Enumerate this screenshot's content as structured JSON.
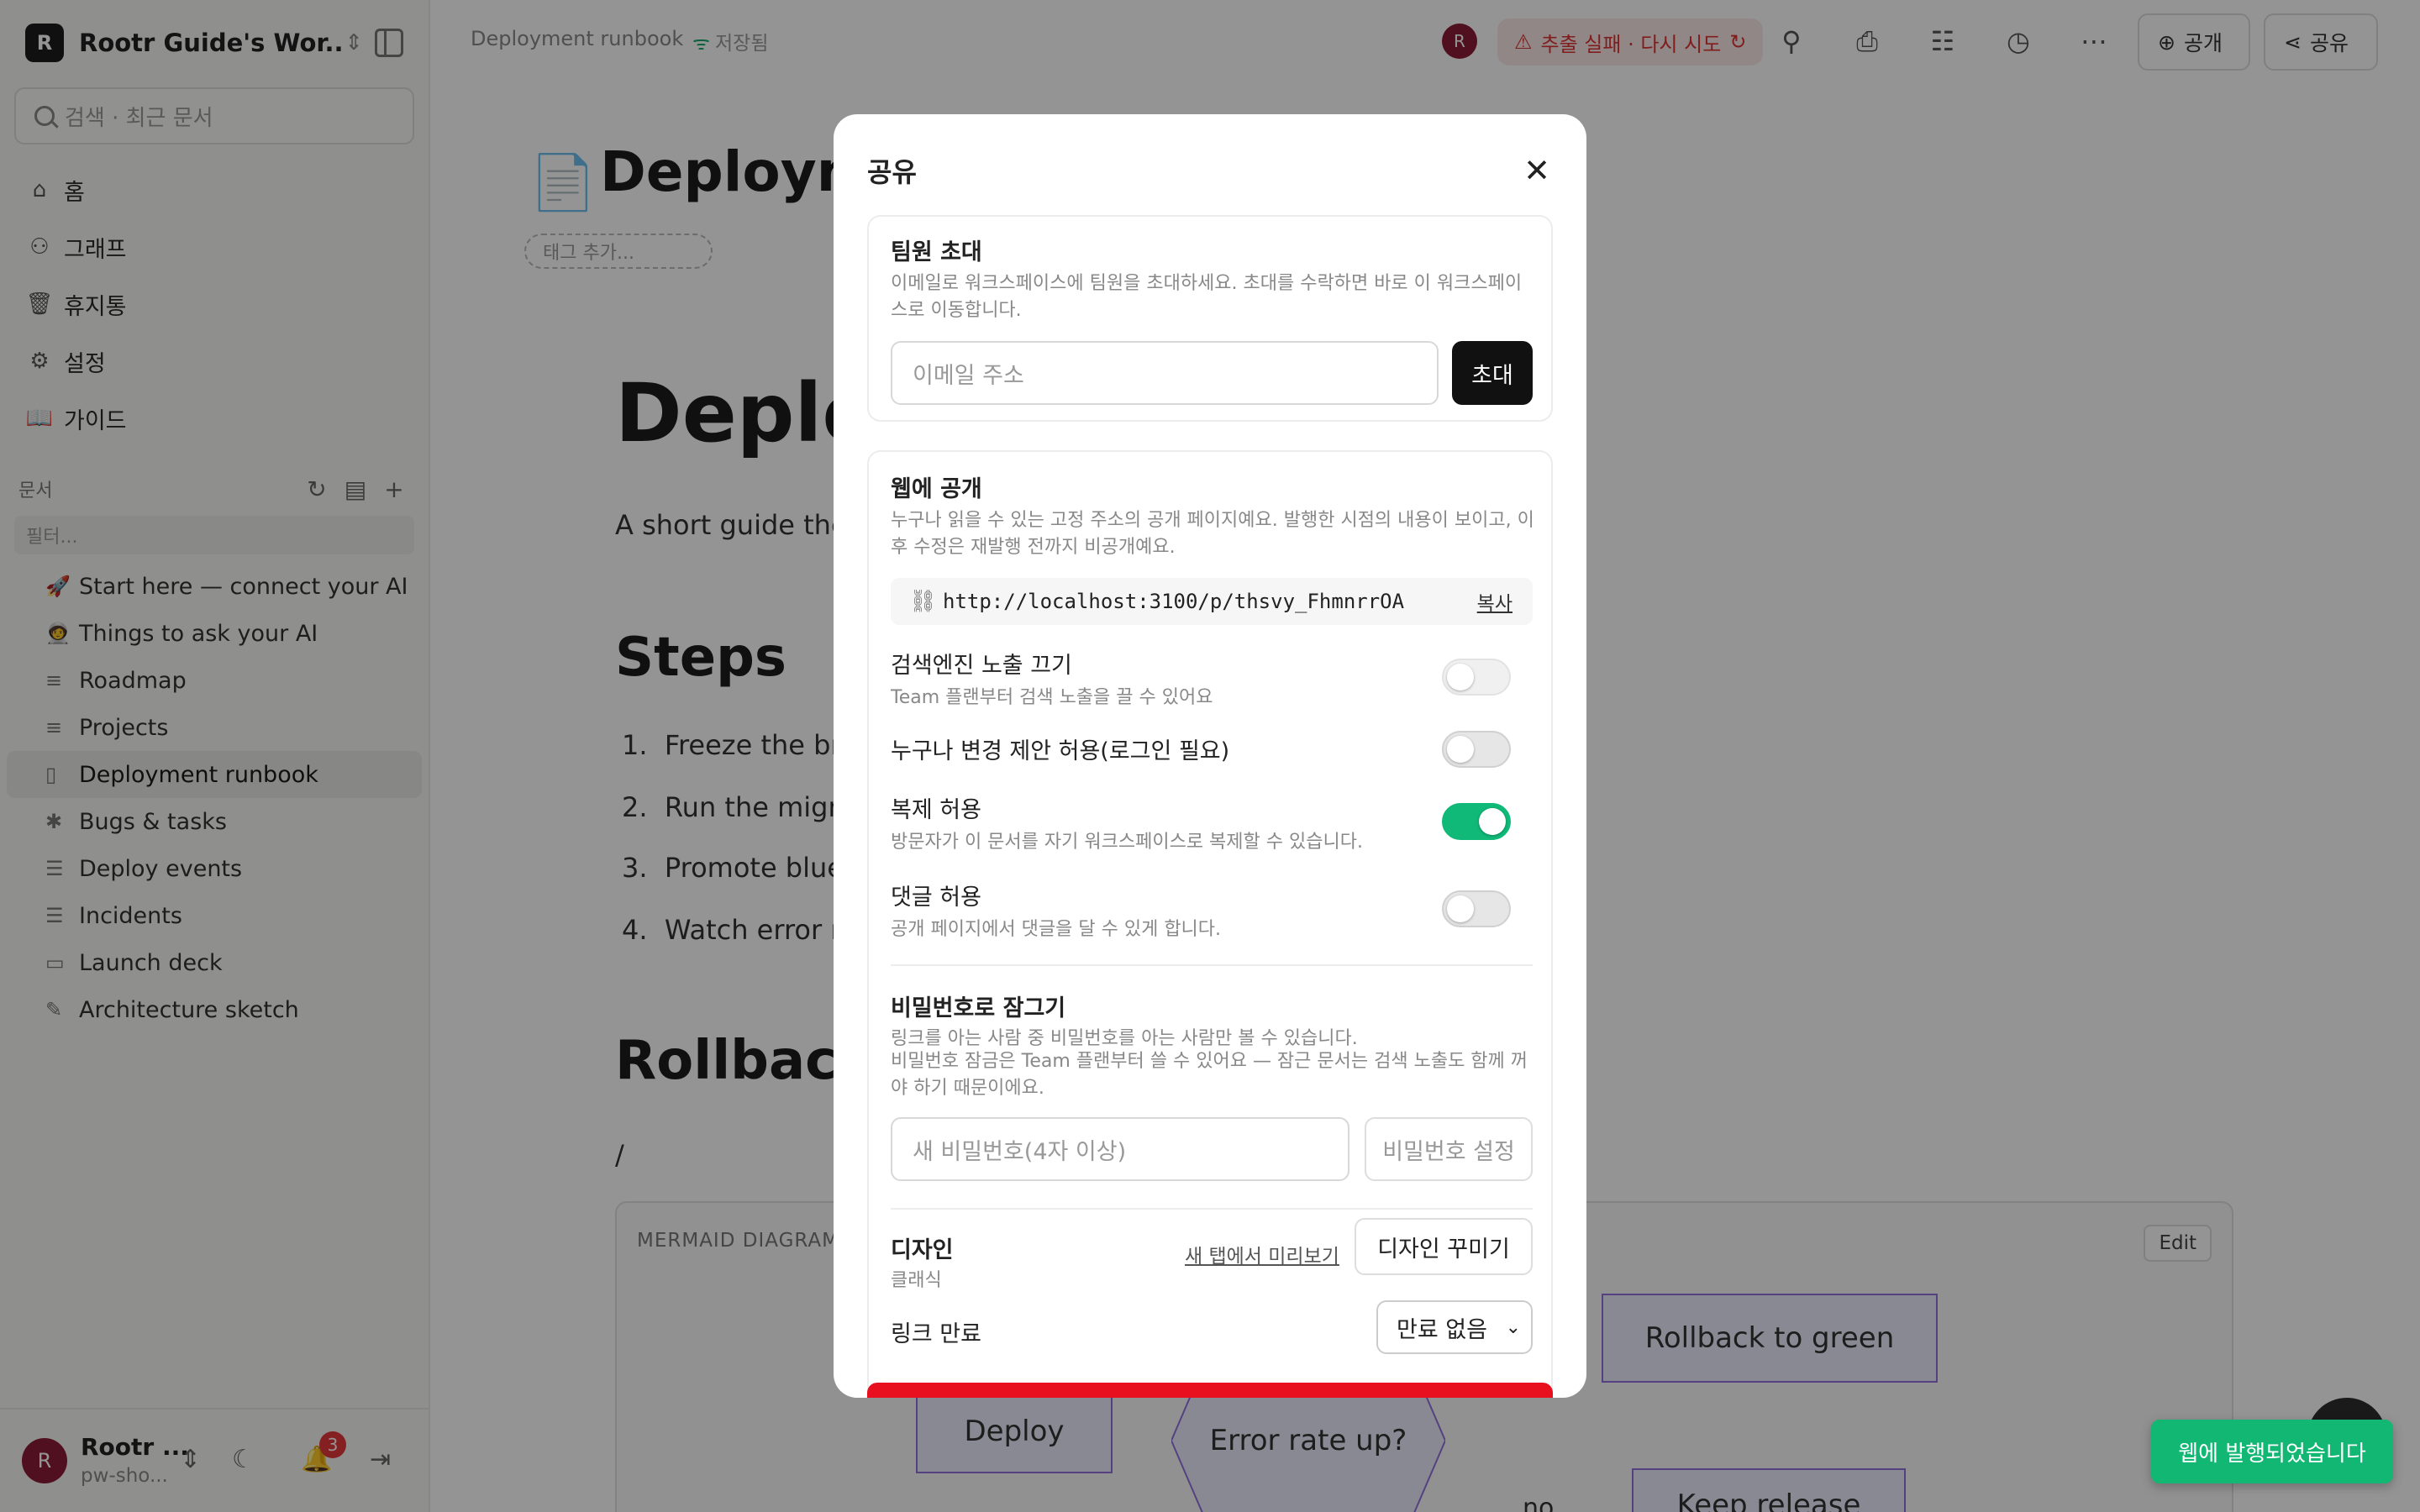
{
  "workspace": {
    "initial": "R",
    "name": "Rootr Guide's Wor..."
  },
  "search": {
    "placeholder": "검색 · 최근 문서"
  },
  "nav": [
    {
      "label": "홈",
      "icon": "home-icon"
    },
    {
      "label": "그래프",
      "icon": "graph-icon"
    },
    {
      "label": "휴지통",
      "icon": "trash-icon"
    },
    {
      "label": "설정",
      "icon": "gear-icon"
    },
    {
      "label": "가이드",
      "icon": "book-icon"
    }
  ],
  "docs": {
    "header": "문서",
    "filter_placeholder": "필터...",
    "items": [
      {
        "label": "Start here — connect your AI",
        "icon": "🚀"
      },
      {
        "label": "Things to ask your AI",
        "icon": "🧑‍🚀"
      },
      {
        "label": "Roadmap",
        "icon": "database-icon"
      },
      {
        "label": "Projects",
        "icon": "database-icon"
      },
      {
        "label": "Deployment runbook",
        "icon": "page-icon"
      },
      {
        "label": "Bugs & tasks",
        "icon": "bug-icon"
      },
      {
        "label": "Deploy events",
        "icon": "timeline-icon"
      },
      {
        "label": "Incidents",
        "icon": "timeline-icon"
      },
      {
        "label": "Launch deck",
        "icon": "slides-icon"
      },
      {
        "label": "Architecture sketch",
        "icon": "sketch-icon"
      }
    ]
  },
  "user": {
    "initial": "R",
    "name": "Rootr ...",
    "sub": "pw-sho...",
    "notifications": "3"
  },
  "topbar": {
    "breadcrumb": "Deployment runbook",
    "saved": "저장됨",
    "avatar": "R",
    "error": "추출 실패 · 다시 시도",
    "publish_label": "공개",
    "share_label": "공유"
  },
  "doc": {
    "emoji": "📄",
    "title": "Deployme",
    "tag_placeholder": "태그 추가...",
    "h1": "Deplo",
    "intro": "A short guide the",
    "steps_heading": "Steps",
    "steps": [
      "Freeze the bra",
      "Run the migra",
      "Promote blue",
      "Watch error ra"
    ],
    "rollback_heading": "Rollback",
    "slash": "/",
    "mermaid": {
      "label": "MERMAID DIAGRAM",
      "edit": "Edit",
      "nodes": {
        "rollback": "Rollback to green",
        "deploy": "Deploy",
        "error_rate": "Error rate up?",
        "keep": "Keep release",
        "no": "no"
      }
    }
  },
  "modal": {
    "title": "공유",
    "invite": {
      "title": "팀원 초대",
      "desc": "이메일로 워크스페이스에 팀원을 초대하세요. 초대를 수락하면 바로 이 워크스페이스로 이동합니다.",
      "email_placeholder": "이메일 주소",
      "button": "초대"
    },
    "publish": {
      "title": "웹에 공개",
      "desc": "누구나 읽을 수 있는 고정 주소의 공개 페이지예요. 발행한 시점의 내용이 보이고, 이후 수정은 재발행 전까지 비공개예요.",
      "url": "http://localhost:3100/p/thsvy_FhmnrrOA",
      "copy": "복사",
      "options": [
        {
          "title": "검색엔진 노출 끄기",
          "desc": "Team 플랜부터 검색 노출을 끌 수 있어요",
          "state": "disabled"
        },
        {
          "title": "누구나 변경 제안 허용(로그인 필요)",
          "desc": "",
          "state": "off"
        },
        {
          "title": "복제 허용",
          "desc": "방문자가 이 문서를 자기 워크스페이스로 복제할 수 있습니다.",
          "state": "on"
        },
        {
          "title": "댓글 허용",
          "desc": "공개 페이지에서 댓글을 달 수 있게 합니다.",
          "state": "off"
        }
      ],
      "password": {
        "title": "비밀번호로 잠그기",
        "desc1": "링크를 아는 사람 중 비밀번호를 아는 사람만 볼 수 있습니다.",
        "desc2": "비밀번호 잠금은 Team 플랜부터 쓸 수 있어요 — 잠근 문서는 검색 노출도 함께 꺼야 하기 때문이에요.",
        "placeholder": "새 비밀번호(4자 이상)",
        "button": "비밀번호 설정"
      },
      "design": {
        "title": "디자인",
        "value": "클래식",
        "preview": "새 탭에서 미리보기",
        "button": "디자인 꾸미기"
      },
      "expiry": {
        "title": "링크 만료",
        "value": "만료 없음"
      }
    }
  },
  "toast": "웹에 발행되었습니다",
  "colors": {
    "accent": "#10b978",
    "danger": "#e8101f",
    "toast": "#12b773"
  }
}
